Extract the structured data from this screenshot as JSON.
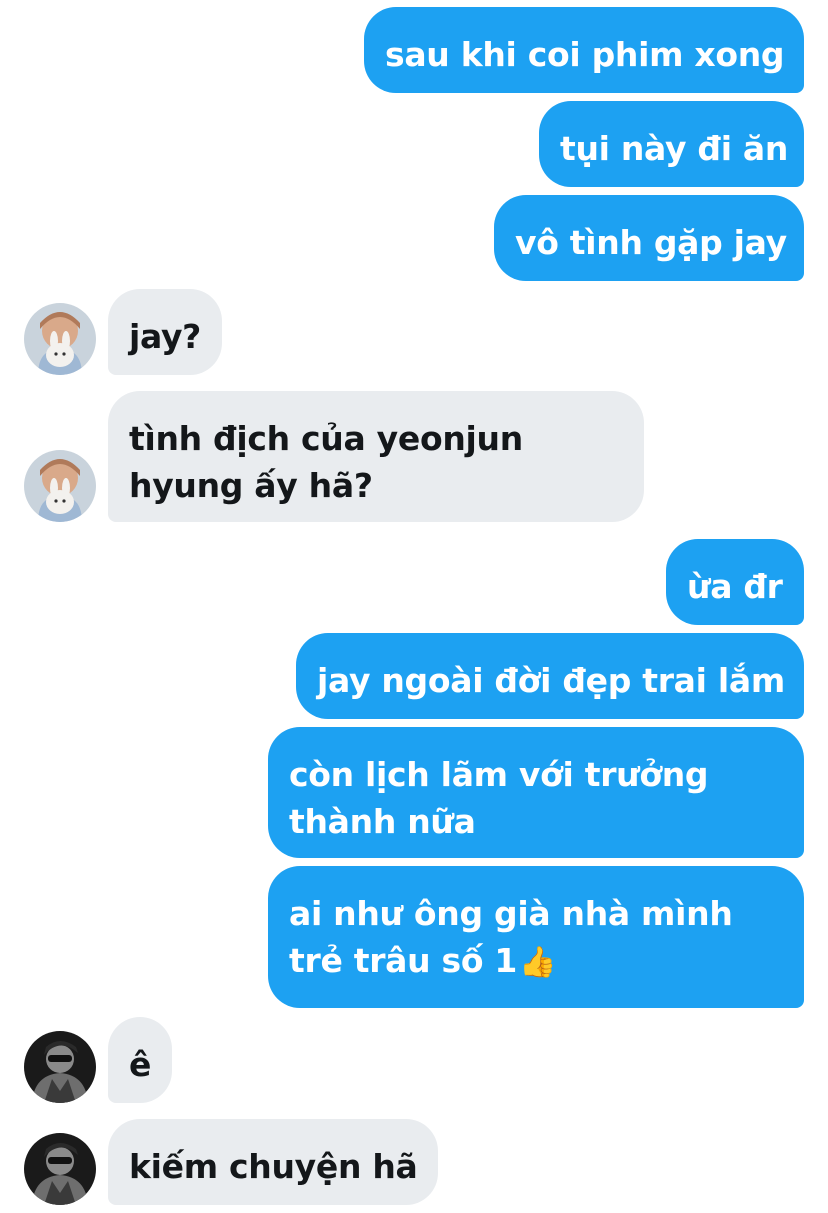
{
  "conversation": {
    "messages": [
      {
        "sender": "me",
        "lines": [
          "sau khi coi phim xong"
        ]
      },
      {
        "sender": "me",
        "lines": [
          "tụi này đi ăn"
        ]
      },
      {
        "sender": "me",
        "lines": [
          "vô tình gặp jay"
        ]
      },
      {
        "sender": "contact_a",
        "lines": [
          "jay?"
        ]
      },
      {
        "sender": "contact_a",
        "lines": [
          "tình địch của yeonjun",
          "hyung ấy hã?"
        ]
      },
      {
        "sender": "me",
        "lines": [
          "ừa đr"
        ]
      },
      {
        "sender": "me",
        "lines": [
          "jay ngoài đời đẹp trai lắm"
        ]
      },
      {
        "sender": "me",
        "lines": [
          "còn lịch lãm với trưởng",
          "thành nữa"
        ]
      },
      {
        "sender": "me",
        "lines": [
          "ai như ông già nhà mình",
          "trẻ trâu số 1"
        ],
        "trailing_emoji": "👍"
      },
      {
        "sender": "contact_b",
        "lines": [
          "ê"
        ]
      },
      {
        "sender": "contact_b",
        "lines": [
          "kiếm chuyện hã"
        ]
      }
    ]
  },
  "colors": {
    "outgoing_bubble": "#1da1f2",
    "outgoing_text": "#ffffff",
    "incoming_bubble": "#e9ecef",
    "incoming_text": "#14171a"
  },
  "avatars": {
    "contact_a": "avatar-photo-person-holding-plush-bunny",
    "contact_b": "avatar-photo-person-monochrome"
  }
}
